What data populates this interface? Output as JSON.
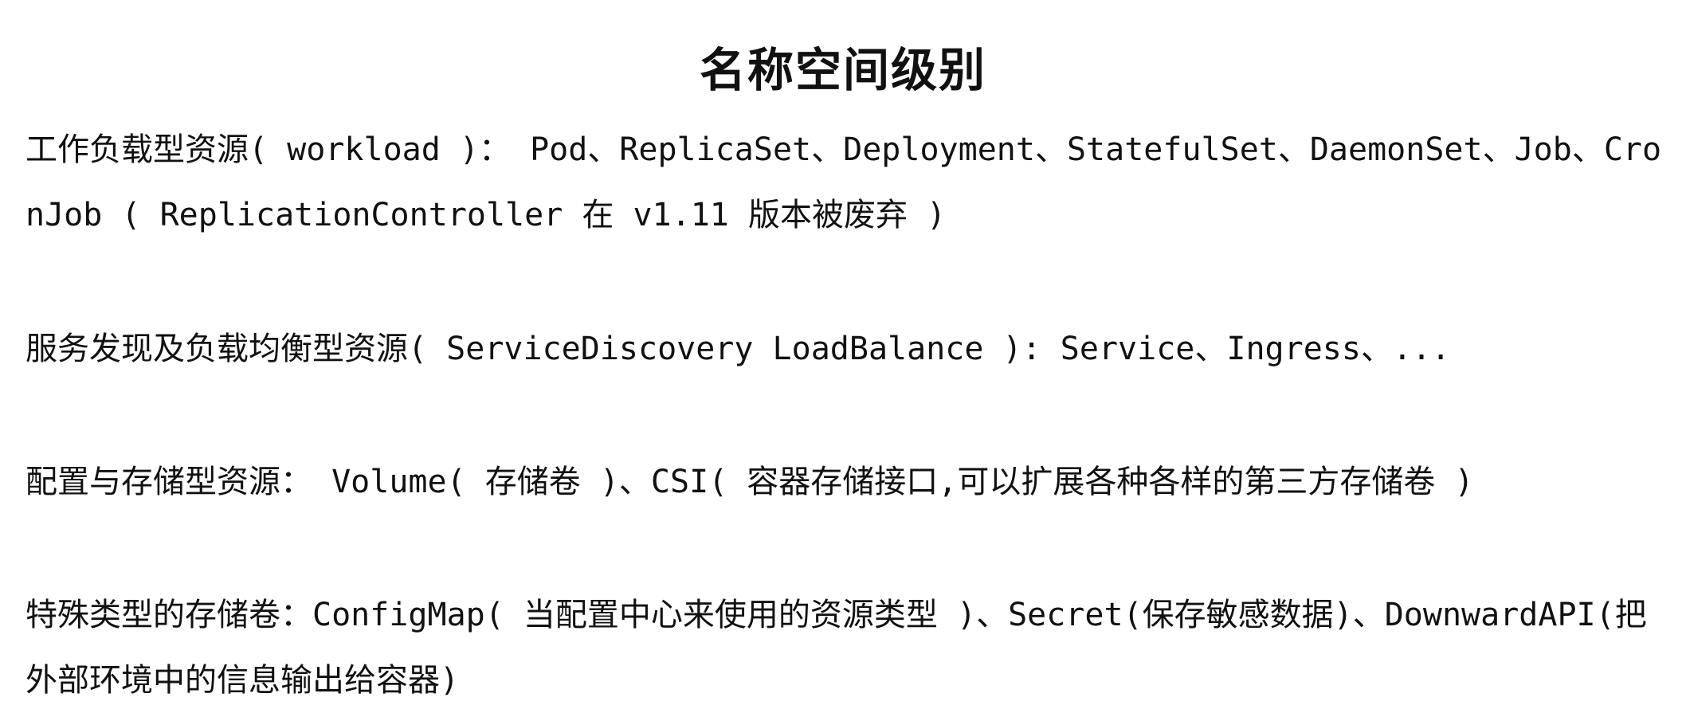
{
  "title": "名称空间级别",
  "sections": [
    {
      "text": "工作负载型资源( workload )： Pod、ReplicaSet、Deployment、StatefulSet、DaemonSet、Job、CronJob ( ReplicationController 在 v1.11 版本被废弃 )"
    },
    {
      "text": "服务发现及负载均衡型资源( ServiceDiscovery LoadBalance ): Service、Ingress、..."
    },
    {
      "text": "配置与存储型资源： Volume( 存储卷 )、CSI( 容器存储接口,可以扩展各种各样的第三方存储卷 )"
    },
    {
      "text": "特殊类型的存储卷：ConfigMap( 当配置中心来使用的资源类型 )、Secret(保存敏感数据)、DownwardAPI(把外部环境中的信息输出给容器)"
    }
  ]
}
